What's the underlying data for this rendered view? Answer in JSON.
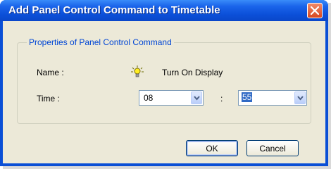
{
  "dialog": {
    "title": "Add Panel Control Command to Timetable"
  },
  "group": {
    "legend": "Properties of Panel Control Command"
  },
  "fields": {
    "name_label": "Name :",
    "name_value": "Turn On Display",
    "name_icon": "lightbulb-icon",
    "time_label": "Time :",
    "hour_value": "08",
    "separator": ":",
    "minute_value": "55"
  },
  "buttons": {
    "ok": "OK",
    "cancel": "Cancel"
  },
  "colors": {
    "title_bar": "#0a4fd6",
    "group_legend": "#0046d5",
    "selection": "#316ac5",
    "close_button": "#d8471f"
  }
}
